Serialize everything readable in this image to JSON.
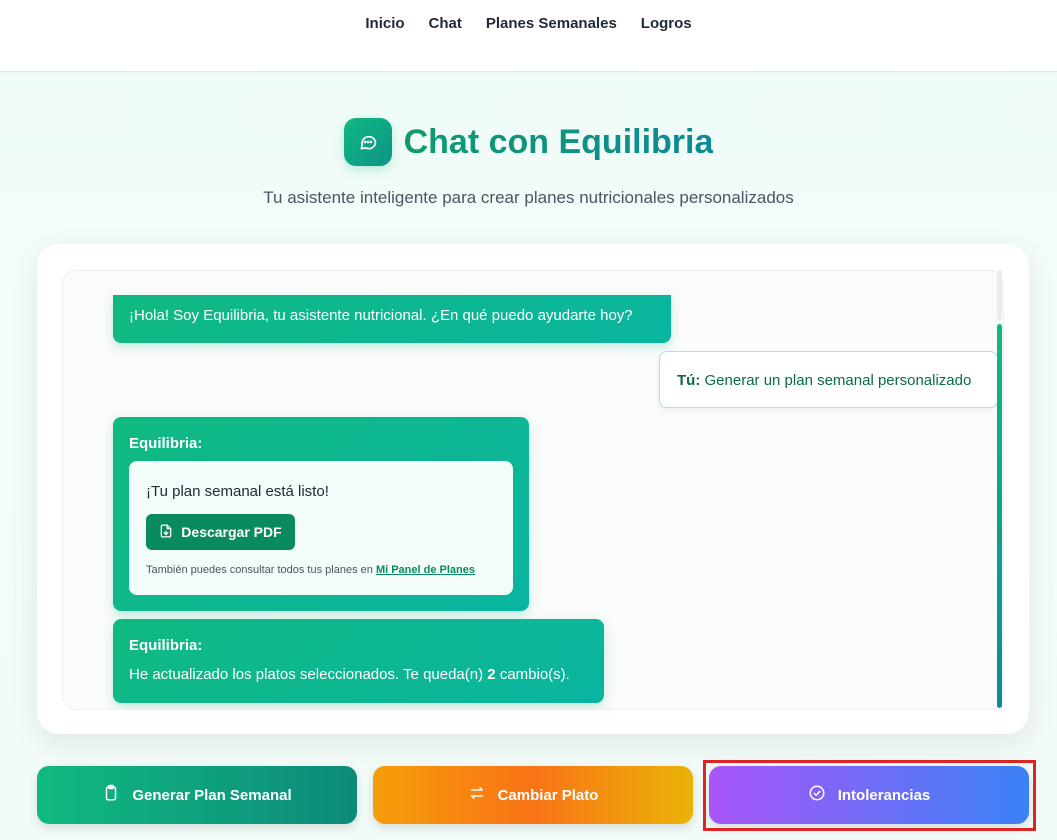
{
  "nav": {
    "items": [
      {
        "label": "Inicio"
      },
      {
        "label": "Chat"
      },
      {
        "label": "Planes Semanales"
      },
      {
        "label": "Logros"
      }
    ]
  },
  "header": {
    "title": "Chat con Equilibria",
    "subtitle": "Tu asistente inteligente para crear planes nutricionales personalizados",
    "icon": "chat-bubble-icon"
  },
  "chat": {
    "messages": [
      {
        "from": "bot",
        "text": "¡Hola! Soy Equilibria, tu asistente nutricional. ¿En qué puedo ayudarte hoy?"
      },
      {
        "from": "user",
        "speaker": "Tú:",
        "text": "Generar un plan semanal personalizado"
      },
      {
        "from": "bot",
        "speaker": "Equilibria:",
        "card": {
          "heading": "¡Tu plan semanal está listo!",
          "button_label": "Descargar PDF",
          "note_prefix": "También puedes consultar todos tus planes en",
          "link_label": "Mi Panel de Planes"
        }
      },
      {
        "from": "bot",
        "speaker": "Equilibria:",
        "text_before": "He actualizado los platos seleccionados. Te queda(n)",
        "count": "2",
        "text_after": "cambio(s)."
      }
    ]
  },
  "actions": {
    "generate_label": "Generar Plan Semanal",
    "swap_label": "Cambiar Plato",
    "intolerances_label": "Intolerancias"
  },
  "colors": {
    "brand": "#10b981",
    "brand_dark": "#0a8a5f",
    "highlight": "#dc2626"
  }
}
